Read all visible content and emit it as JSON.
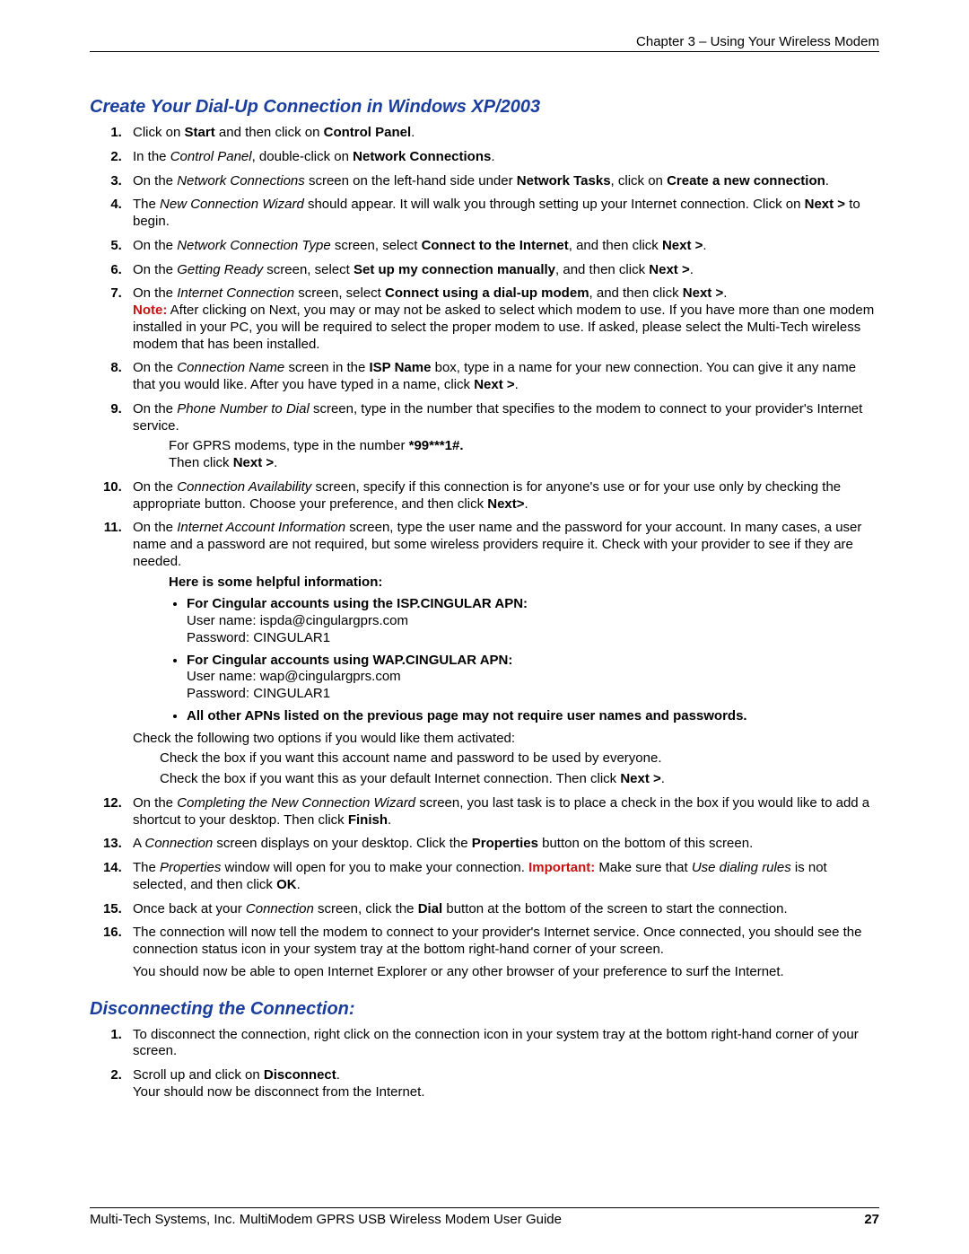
{
  "header": "Chapter 3 – Using Your Wireless Modem",
  "section1_title": "Create Your Dial-Up Connection in Windows XP/2003",
  "s1": {
    "i1_a": "Click on ",
    "i1_b": "Start",
    "i1_c": " and then click on ",
    "i1_d": "Control Panel",
    "i1_e": ".",
    "i2_a": "In the ",
    "i2_b": "Control Panel",
    "i2_c": ", double-click on ",
    "i2_d": "Network Connections",
    "i2_e": ".",
    "i3_a": "On the ",
    "i3_b": "Network Connections",
    "i3_c": " screen on the left-hand side under ",
    "i3_d": "Network Tasks",
    "i3_e": ", click on ",
    "i3_f": "Create a new connection",
    "i3_g": ".",
    "i4_a": "The ",
    "i4_b": "New Connection Wizard",
    "i4_c": " should appear. It will walk you through setting up your Internet connection. Click on ",
    "i4_d": "Next >",
    "i4_e": " to begin.",
    "i5_a": "On the ",
    "i5_b": "Network Connection Type",
    "i5_c": " screen, select ",
    "i5_d": "Connect to the Internet",
    "i5_e": ", and then click ",
    "i5_f": "Next >",
    "i5_g": ".",
    "i6_a": "On the ",
    "i6_b": "Getting Ready",
    "i6_c": " screen, select ",
    "i6_d": "Set up my connection manually",
    "i6_e": ", and then click ",
    "i6_f": "Next >",
    "i6_g": ".",
    "i7_a": "On the ",
    "i7_b": "Internet Connection",
    "i7_c": " screen, select ",
    "i7_d": "Connect using a dial-up modem",
    "i7_e": ", and then click ",
    "i7_f": "Next >",
    "i7_g": ".",
    "i7_note": "Note:",
    "i7_after": " After clicking on Next, you may or may not be asked to select which modem to use. If you have more than one modem installed in your PC, you will be required to select the proper modem to use. If asked, please select the Multi-Tech wireless modem that has been installed.",
    "i8_a": "On the ",
    "i8_b": "Connection Name",
    "i8_c": " screen in the ",
    "i8_d": "ISP Name",
    "i8_e": " box, type in a name for your new connection. You can give it any name that you would like. After you have typed in a name, click ",
    "i8_f": "Next >",
    "i8_g": ".",
    "i9_a": "On the ",
    "i9_b": "Phone Number to Dial",
    "i9_c": " screen, type in the number that specifies to the modem to connect to your provider's Internet service.",
    "i9_sub_a": "For GPRS modems, type in the number ",
    "i9_sub_b": "*99***1#.",
    "i9_sub_c": "Then click ",
    "i9_sub_d": "Next >",
    "i9_sub_e": ".",
    "i10_a": "On the ",
    "i10_b": "Connection Availability",
    "i10_c": " screen, specify if this connection is for anyone's use or for your use only by checking the appropriate button. Choose your preference, and then click ",
    "i10_d": "Next>",
    "i10_e": ".",
    "i11_a": "On the ",
    "i11_b": "Internet Account Information",
    "i11_c": " screen, type the user name and the password for your account. In many cases, a user name and a password are not required, but some wireless providers require it. Check with your provider to see if they are needed.",
    "i11_help_header": "Here is some helpful information:",
    "i11_b1_t": "For Cingular accounts using the ISP.CINGULAR APN:",
    "i11_b1_u": "User name: ispda@cingulargprs.com",
    "i11_b1_p": "Password: CINGULAR1",
    "i11_b2_t": "For Cingular accounts using WAP.CINGULAR APN:",
    "i11_b2_u": "User name: wap@cingulargprs.com",
    "i11_b2_p": "Password: CINGULAR1",
    "i11_b3_t": "All other APNs listed on the previous page may not require user names and passwords.",
    "i11_check_intro": "Check the following two options if you would like them activated:",
    "i11_check1": "Check the box if you want this account name and password to be used by everyone.",
    "i11_check2_a": "Check the box if you want this as your default Internet connection. Then click ",
    "i11_check2_b": "Next >",
    "i11_check2_c": ".",
    "i12_a": "On the ",
    "i12_b": "Completing the New Connection Wizard",
    "i12_c": " screen, you last task is to place a check in the box if you would like to add a shortcut to your desktop. Then click ",
    "i12_d": "Finish",
    "i12_e": ".",
    "i13_a": "A ",
    "i13_b": "Connection",
    "i13_c": " screen displays on your desktop. Click the ",
    "i13_d": "Properties",
    "i13_e": " button on the bottom of this screen.",
    "i14_a": "The ",
    "i14_b": "Properties",
    "i14_c": " window will open for you to make your connection. ",
    "i14_imp": "Important:",
    "i14_d": " Make sure that ",
    "i14_e": "Use dialing rules",
    "i14_f": " is not selected, and then click ",
    "i14_g": "OK",
    "i14_h": ".",
    "i15_a": "Once back at your ",
    "i15_b": "Connection",
    "i15_c": " screen, click the ",
    "i15_d": "Dial",
    "i15_e": " button at the bottom of the screen to start the connection.",
    "i16_a": "The connection will now tell the modem to connect to your provider's Internet service. Once connected, you should see the connection status icon in your system tray at the bottom right-hand corner of your screen.",
    "i16_b": "You should now be able to open Internet Explorer or any other browser of your preference to surf the Internet."
  },
  "section2_title": "Disconnecting the Connection:",
  "s2": {
    "i1": "To disconnect the connection, right click on the connection icon in your system tray at the bottom right-hand corner of your screen.",
    "i2_a": "Scroll up and click on ",
    "i2_b": "Disconnect",
    "i2_c": ".",
    "i2_d": "Your should now be disconnect from the Internet."
  },
  "footer_text": "Multi-Tech Systems, Inc. MultiModem GPRS USB Wireless Modem User Guide",
  "footer_page": "27"
}
